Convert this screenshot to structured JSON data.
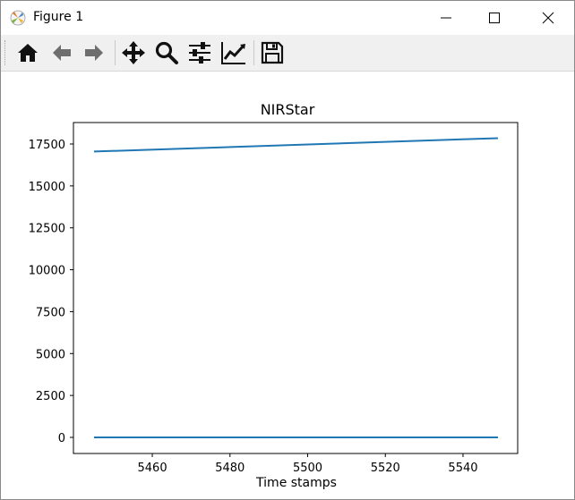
{
  "window": {
    "title": "Figure 1",
    "icons": [
      "matplotlib-icon",
      "minimize-icon",
      "maximize-icon",
      "close-icon"
    ]
  },
  "toolbar": {
    "buttons": [
      "home-icon",
      "back-arrow-icon",
      "forward-arrow-icon",
      "pan-icon",
      "zoom-icon",
      "configure-subplots-icon",
      "edit-axis-icon",
      "save-icon"
    ]
  },
  "chart_data": {
    "type": "line",
    "title": "NIRStar",
    "xlabel": "Time stamps",
    "ylabel": "",
    "xlim": [
      5543.2,
      5551.8
    ],
    "ylim": [
      -893,
      18643
    ],
    "xticks": [
      5460,
      5480,
      5500,
      5520,
      5540
    ],
    "yticks": [
      0,
      2500,
      5000,
      7500,
      10000,
      12500,
      15000,
      17500
    ],
    "grid": false,
    "series": [
      {
        "color": "#1f77b4",
        "x": [
          5445,
          5549
        ],
        "y": [
          17050,
          17850
        ]
      },
      {
        "color": "#1f77b4",
        "x": [
          5445,
          5549
        ],
        "y": [
          0,
          0
        ]
      }
    ]
  }
}
